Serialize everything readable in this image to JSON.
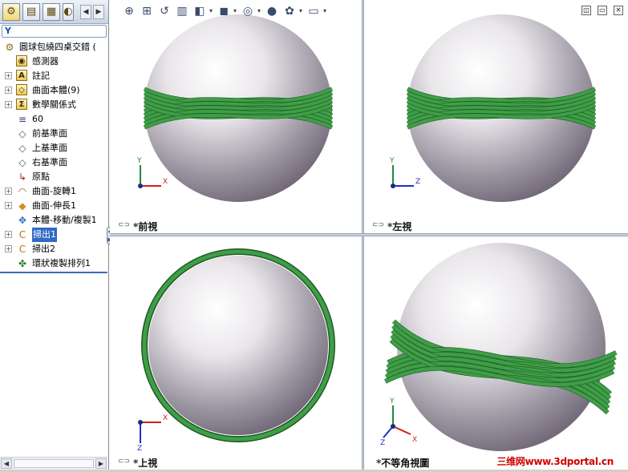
{
  "panel_tabs": [
    {
      "icon": "feature-manager-icon",
      "glyph": "⚙"
    },
    {
      "icon": "property-manager-icon",
      "glyph": "▤"
    },
    {
      "icon": "configuration-manager-icon",
      "glyph": "▦"
    },
    {
      "icon": "display-manager-icon",
      "glyph": "◐"
    }
  ],
  "panel_nav": {
    "prev": "◀",
    "next": "▶"
  },
  "filter_glyph": "Y",
  "tree": [
    {
      "label": "圓球包繞四桌交錯  (",
      "icon": "part-icon",
      "glyph": "⚙",
      "expand": false,
      "indent": 0
    },
    {
      "label": "感測器",
      "icon": "sensors-icon",
      "glyph": "◉",
      "expand": false,
      "indent": 1
    },
    {
      "label": "註記",
      "icon": "annotations-icon",
      "glyph": "A",
      "expand": true,
      "indent": 1
    },
    {
      "label": "曲面本體(9)",
      "icon": "surface-bodies-icon",
      "glyph": "◇",
      "expand": true,
      "indent": 1
    },
    {
      "label": "數學關係式",
      "icon": "equations-icon",
      "glyph": "Σ",
      "expand": true,
      "indent": 1
    },
    {
      "label": "60",
      "icon": "material-icon",
      "glyph": "≡",
      "expand": false,
      "indent": 1
    },
    {
      "label": "前基準面",
      "icon": "plane-icon",
      "glyph": "◇",
      "expand": false,
      "indent": 1
    },
    {
      "label": "上基準面",
      "icon": "plane-icon",
      "glyph": "◇",
      "expand": false,
      "indent": 1
    },
    {
      "label": "右基準面",
      "icon": "plane-icon",
      "glyph": "◇",
      "expand": false,
      "indent": 1
    },
    {
      "label": "原點",
      "icon": "origin-icon",
      "glyph": "↳",
      "expand": false,
      "indent": 1
    },
    {
      "label": "曲面-旋轉1",
      "icon": "revolve-surface-icon",
      "glyph": "◠",
      "expand": true,
      "indent": 1
    },
    {
      "label": "曲面-伸長1",
      "icon": "extrude-surface-icon",
      "glyph": "◆",
      "expand": true,
      "indent": 1
    },
    {
      "label": "本體-移動/複製1",
      "icon": "move-copy-body-icon",
      "glyph": "✥",
      "expand": false,
      "indent": 1
    },
    {
      "label": "掃出1",
      "icon": "sweep-icon",
      "glyph": "C",
      "expand": true,
      "indent": 1,
      "selected": true
    },
    {
      "label": "掃出2",
      "icon": "sweep-icon",
      "glyph": "C",
      "expand": true,
      "indent": 1
    },
    {
      "label": "環狀複製排列1",
      "icon": "circular-pattern-icon",
      "glyph": "✤",
      "expand": false,
      "indent": 1
    }
  ],
  "toolbar": [
    {
      "icon": "zoom-to-fit-icon",
      "glyph": "⊕"
    },
    {
      "icon": "zoom-to-area-icon",
      "glyph": "⊞"
    },
    {
      "icon": "previous-view-icon",
      "glyph": "↺"
    },
    {
      "icon": "section-view-icon",
      "glyph": "▥"
    },
    {
      "icon": "view-orientation-icon",
      "glyph": "◧",
      "dropdown": true
    },
    {
      "icon": "display-style-icon",
      "glyph": "◼",
      "dropdown": true
    },
    {
      "icon": "hide-show-items-icon",
      "glyph": "◎",
      "dropdown": true
    },
    {
      "icon": "edit-appearance-icon",
      "glyph": "●"
    },
    {
      "icon": "apply-scene-icon",
      "glyph": "✿",
      "dropdown": true
    },
    {
      "icon": "view-settings-icon",
      "glyph": "▭",
      "dropdown": true
    }
  ],
  "window_controls": {
    "restore": "◫",
    "minimize": "▭",
    "close": "✕"
  },
  "viewports": [
    {
      "label": "*前視",
      "view": "front",
      "axes": [
        "Y",
        "X"
      ]
    },
    {
      "label": "*左視",
      "view": "left",
      "axes": [
        "Y",
        "Z"
      ]
    },
    {
      "label": "*上視",
      "view": "top",
      "axes": [
        "X",
        "Z"
      ]
    },
    {
      "label": "*不等角視圖",
      "view": "isometric",
      "axes": [
        "Y",
        "X",
        "Z"
      ]
    }
  ],
  "watermark": "三维网www.3dportal.cn",
  "colors": {
    "selection": "#316ac5",
    "ring_green": "#3f9e47",
    "sphere_light": "#e9e6ea",
    "sphere_dark": "#6d6474",
    "axis_x": "#d02020",
    "axis_y": "#1f8a3a",
    "axis_z": "#2030c0",
    "watermark": "#d00000"
  }
}
